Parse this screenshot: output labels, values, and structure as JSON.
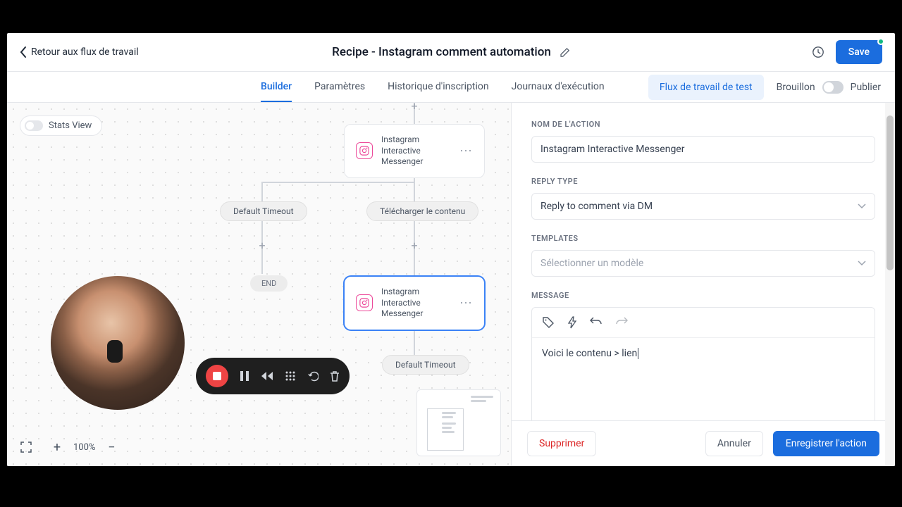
{
  "header": {
    "back_label": "Retour aux flux de travail",
    "title": "Recipe - Instagram comment automation",
    "save_label": "Save"
  },
  "tabs": {
    "builder": "Builder",
    "params": "Paramètres",
    "history": "Historique d'inscription",
    "logs": "Journaux d'exécution",
    "test_btn": "Flux de travail de test",
    "draft": "Brouillon",
    "publish": "Publier"
  },
  "canvas": {
    "stats_view": "Stats View",
    "node_ig_1": "Instagram Interactive Messenger",
    "pill_timeout_1": "Default Timeout",
    "pill_download": "Télécharger le contenu",
    "end": "END",
    "node_ig_2": "Instagram Interactive Messenger",
    "pill_timeout_2": "Default Timeout",
    "zoom_pct": "100%"
  },
  "panel": {
    "action_name_label": "NOM DE L'ACTION",
    "action_name_value": "Instagram Interactive Messenger",
    "reply_type_label": "REPLY TYPE",
    "reply_type_value": "Reply to comment via DM",
    "templates_label": "TEMPLATES",
    "templates_placeholder": "Sélectionner un modèle",
    "message_label": "MESSAGE",
    "message_text": "Voici le contenu > lien",
    "delete": "Supprimer",
    "cancel": "Annuler",
    "save_action": "Enregistrer l'action"
  }
}
